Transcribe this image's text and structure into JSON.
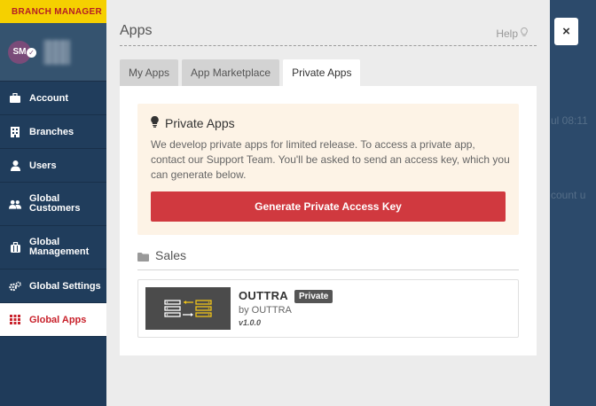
{
  "sidebar": {
    "role_badge": "BRANCH MANAGER",
    "avatar_initials": "SM",
    "items": [
      {
        "label": "Account",
        "icon": "briefcase-icon"
      },
      {
        "label": "Branches",
        "icon": "building-icon"
      },
      {
        "label": "Users",
        "icon": "user-icon"
      },
      {
        "label": "Global Customers",
        "icon": "users-icon"
      },
      {
        "label": "Global Management",
        "icon": "suitcase-icon"
      },
      {
        "label": "Global Settings",
        "icon": "gears-icon"
      },
      {
        "label": "Global Apps",
        "icon": "grid-icon"
      }
    ],
    "active_item": "Global Apps"
  },
  "background": {
    "text_1": "ul 08:11",
    "text_2": "count u"
  },
  "modal": {
    "title": "Apps",
    "help_label": "Help",
    "close_label": "×",
    "tabs": [
      {
        "label": "My Apps",
        "active": false
      },
      {
        "label": "App Marketplace",
        "active": false
      },
      {
        "label": "Private Apps",
        "active": true
      }
    ],
    "notice": {
      "title": "Private Apps",
      "body": "We develop private apps for limited release. To access a private app, contact our Support Team. You'll be asked to send an access key, which you can generate below.",
      "button_label": "Generate Private Access Key"
    },
    "section": {
      "label": "Sales"
    },
    "app": {
      "name": "OUTTRA",
      "badge": "Private",
      "by": "by OUTTRA",
      "version": "v1.0.0"
    }
  },
  "colors": {
    "accent_red": "#d0393f",
    "role_yellow": "#f5d000",
    "sidebar_bg": "#1f3b5a",
    "notice_bg": "#fdf3e6"
  }
}
